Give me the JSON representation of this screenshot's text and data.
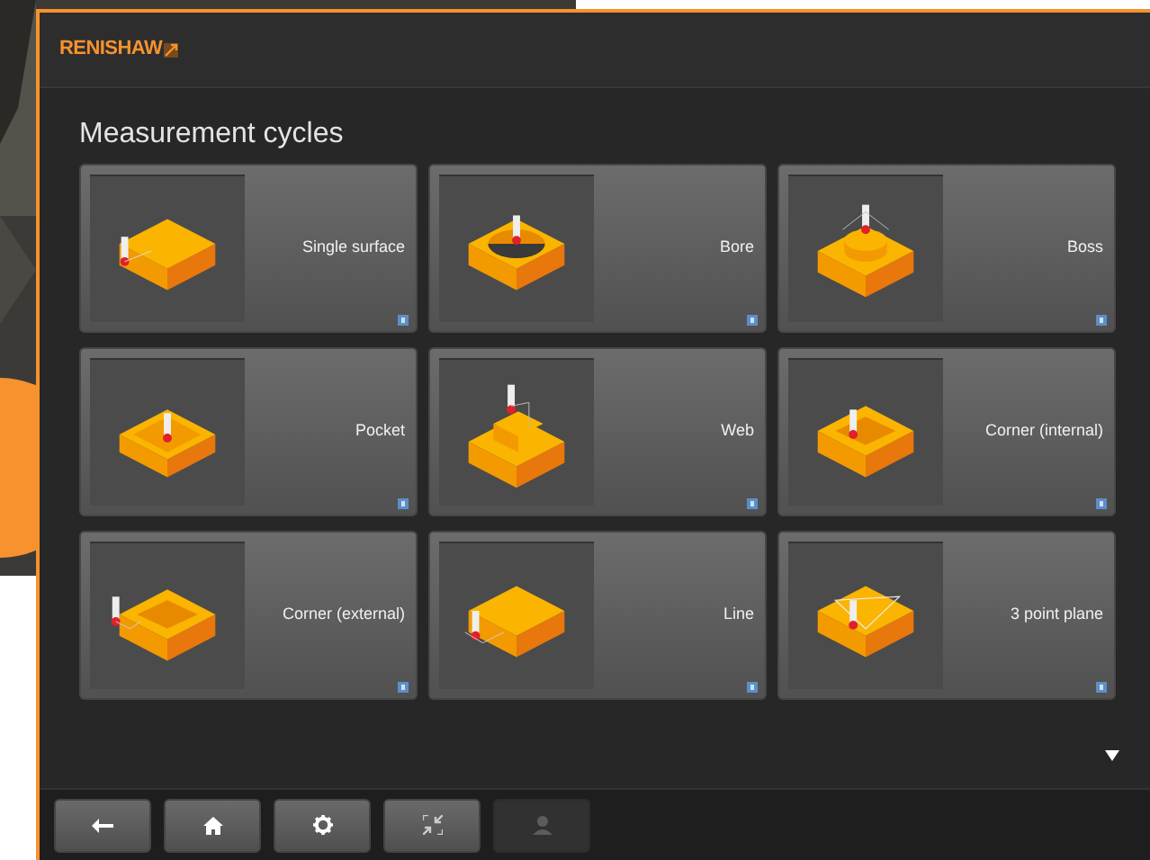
{
  "window": {
    "brand": "RENISHAW"
  },
  "title": "Measurement cycles",
  "cycles": [
    {
      "label": "Single surface",
      "kind": "block"
    },
    {
      "label": "Bore",
      "kind": "bore"
    },
    {
      "label": "Boss",
      "kind": "boss"
    },
    {
      "label": "Pocket",
      "kind": "pocket"
    },
    {
      "label": "Web",
      "kind": "web"
    },
    {
      "label": "Corner (internal)",
      "kind": "corner_internal"
    },
    {
      "label": "Corner (external)",
      "kind": "corner_external"
    },
    {
      "label": "Line",
      "kind": "line"
    },
    {
      "label": "3  point plane",
      "kind": "plane"
    }
  ],
  "toolbar": [
    {
      "kind": "back",
      "disabled": false
    },
    {
      "kind": "home",
      "disabled": false
    },
    {
      "kind": "settings",
      "disabled": false
    },
    {
      "kind": "resize",
      "disabled": false
    },
    {
      "kind": "user",
      "disabled": true
    }
  ]
}
